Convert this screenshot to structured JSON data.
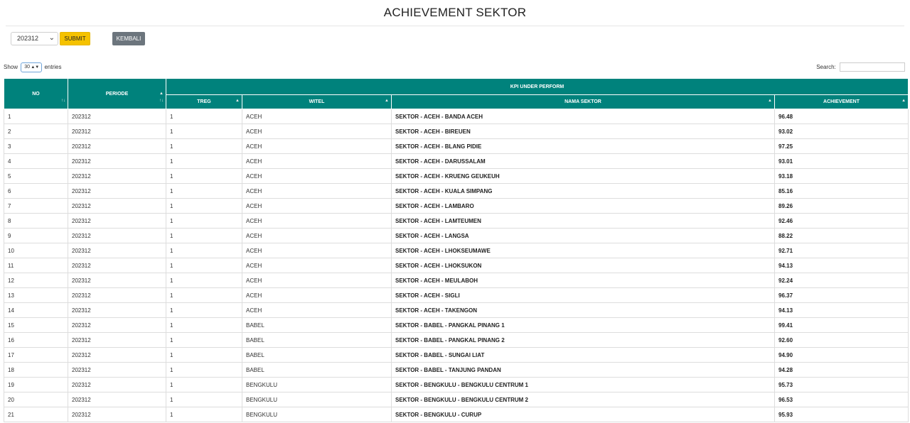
{
  "page": {
    "title": "ACHIEVEMENT SEKTOR"
  },
  "controls": {
    "period_value": "202312",
    "submit_label": "SUBMIT",
    "back_label": "KEMBALI"
  },
  "table_controls": {
    "show_label": "Show",
    "entries_value": "30",
    "entries_label": "entries",
    "search_label": "Search:",
    "search_value": ""
  },
  "table": {
    "group_header": "KPI UNDER PERFORM",
    "headers": {
      "no": "NO",
      "periode": "PERIODE",
      "treg": "TREG",
      "witel": "WITEL",
      "nama_sektor": "NAMA SEKTOR",
      "achievement": "ACHIEVEMENT"
    },
    "rows": [
      {
        "no": "1",
        "periode": "202312",
        "treg": "1",
        "witel": "ACEH",
        "sektor": "SEKTOR - ACEH - BANDA ACEH",
        "achievement": "96.48"
      },
      {
        "no": "2",
        "periode": "202312",
        "treg": "1",
        "witel": "ACEH",
        "sektor": "SEKTOR - ACEH - BIREUEN",
        "achievement": "93.02"
      },
      {
        "no": "3",
        "periode": "202312",
        "treg": "1",
        "witel": "ACEH",
        "sektor": "SEKTOR - ACEH - BLANG PIDIE",
        "achievement": "97.25"
      },
      {
        "no": "4",
        "periode": "202312",
        "treg": "1",
        "witel": "ACEH",
        "sektor": "SEKTOR - ACEH - DARUSSALAM",
        "achievement": "93.01"
      },
      {
        "no": "5",
        "periode": "202312",
        "treg": "1",
        "witel": "ACEH",
        "sektor": "SEKTOR - ACEH - KRUENG GEUKEUH",
        "achievement": "93.18"
      },
      {
        "no": "6",
        "periode": "202312",
        "treg": "1",
        "witel": "ACEH",
        "sektor": "SEKTOR - ACEH - KUALA SIMPANG",
        "achievement": "85.16"
      },
      {
        "no": "7",
        "periode": "202312",
        "treg": "1",
        "witel": "ACEH",
        "sektor": "SEKTOR - ACEH - LAMBARO",
        "achievement": "89.26"
      },
      {
        "no": "8",
        "periode": "202312",
        "treg": "1",
        "witel": "ACEH",
        "sektor": "SEKTOR - ACEH - LAMTEUMEN",
        "achievement": "92.46"
      },
      {
        "no": "9",
        "periode": "202312",
        "treg": "1",
        "witel": "ACEH",
        "sektor": "SEKTOR - ACEH - LANGSA",
        "achievement": "88.22"
      },
      {
        "no": "10",
        "periode": "202312",
        "treg": "1",
        "witel": "ACEH",
        "sektor": "SEKTOR - ACEH - LHOKSEUMAWE",
        "achievement": "92.71"
      },
      {
        "no": "11",
        "periode": "202312",
        "treg": "1",
        "witel": "ACEH",
        "sektor": "SEKTOR - ACEH - LHOKSUKON",
        "achievement": "94.13"
      },
      {
        "no": "12",
        "periode": "202312",
        "treg": "1",
        "witel": "ACEH",
        "sektor": "SEKTOR - ACEH - MEULABOH",
        "achievement": "92.24"
      },
      {
        "no": "13",
        "periode": "202312",
        "treg": "1",
        "witel": "ACEH",
        "sektor": "SEKTOR - ACEH - SIGLI",
        "achievement": "96.37"
      },
      {
        "no": "14",
        "periode": "202312",
        "treg": "1",
        "witel": "ACEH",
        "sektor": "SEKTOR - ACEH - TAKENGON",
        "achievement": "94.13"
      },
      {
        "no": "15",
        "periode": "202312",
        "treg": "1",
        "witel": "BABEL",
        "sektor": "SEKTOR - BABEL - PANGKAL PINANG 1",
        "achievement": "99.41"
      },
      {
        "no": "16",
        "periode": "202312",
        "treg": "1",
        "witel": "BABEL",
        "sektor": "SEKTOR - BABEL - PANGKAL PINANG 2",
        "achievement": "92.60"
      },
      {
        "no": "17",
        "periode": "202312",
        "treg": "1",
        "witel": "BABEL",
        "sektor": "SEKTOR - BABEL - SUNGAI LIAT",
        "achievement": "94.90"
      },
      {
        "no": "18",
        "periode": "202312",
        "treg": "1",
        "witel": "BABEL",
        "sektor": "SEKTOR - BABEL - TANJUNG PANDAN",
        "achievement": "94.28"
      },
      {
        "no": "19",
        "periode": "202312",
        "treg": "1",
        "witel": "BENGKULU",
        "sektor": "SEKTOR - BENGKULU - BENGKULU CENTRUM 1",
        "achievement": "95.73"
      },
      {
        "no": "20",
        "periode": "202312",
        "treg": "1",
        "witel": "BENGKULU",
        "sektor": "SEKTOR - BENGKULU - BENGKULU CENTRUM 2",
        "achievement": "96.53"
      },
      {
        "no": "21",
        "periode": "202312",
        "treg": "1",
        "witel": "BENGKULU",
        "sektor": "SEKTOR - BENGKULU - CURUP",
        "achievement": "95.93"
      }
    ]
  },
  "colors": {
    "header_bg": "#00827c",
    "submit_bg": "#f5c200",
    "back_bg": "#6c757d"
  },
  "icons": {
    "sort": "sort-both-icon",
    "select": "chevron-down-icon"
  }
}
